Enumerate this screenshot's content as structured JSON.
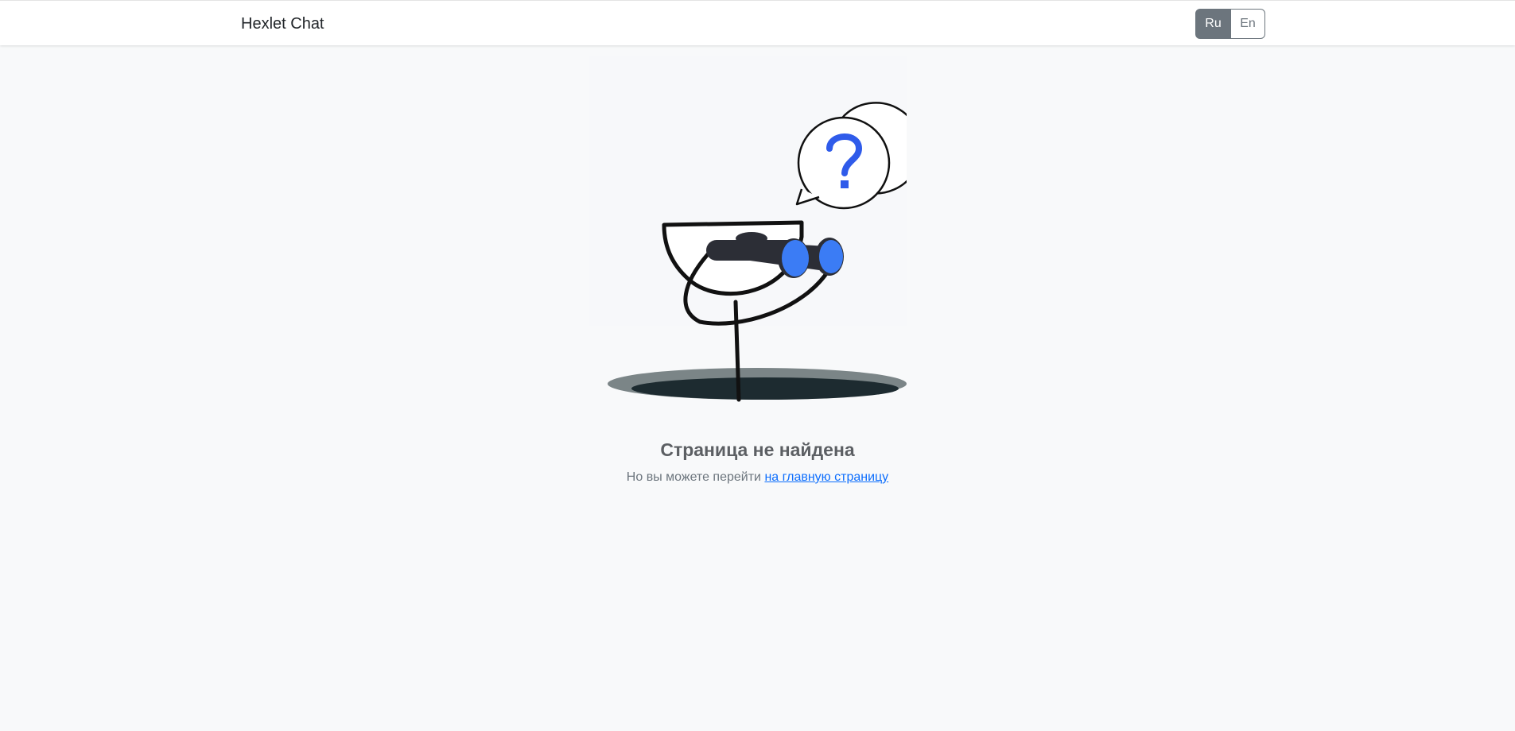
{
  "navbar": {
    "brand": "Hexlet Chat",
    "languages": [
      {
        "label": "Ru",
        "active": true
      },
      {
        "label": "En",
        "active": false
      }
    ]
  },
  "illustration": {
    "icons": [
      "question-bubble-icon",
      "binoculars-icon",
      "hole-icon"
    ],
    "colors": {
      "accent": "#2f5bea",
      "lens": "#3b7cf5",
      "hole": "#1d2b30"
    }
  },
  "main": {
    "title": "Страница не найдена",
    "subtitle_prefix": "Но вы можете перейти ",
    "home_link": "на главную страницу"
  }
}
